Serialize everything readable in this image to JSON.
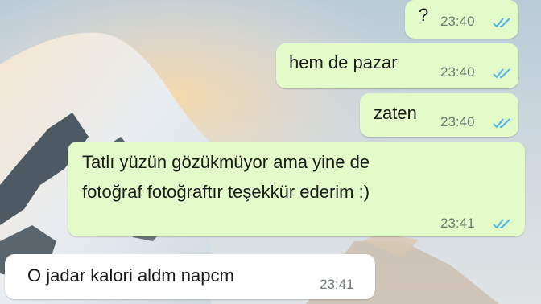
{
  "chat": {
    "messages": [
      {
        "direction": "outgoing",
        "text": "?",
        "time": "23:40",
        "status": "read"
      },
      {
        "direction": "outgoing",
        "text": "hem de pazar",
        "time": "23:40",
        "status": "read"
      },
      {
        "direction": "outgoing",
        "text": "zaten",
        "time": "23:40",
        "status": "read"
      },
      {
        "direction": "outgoing",
        "lines": [
          "Tatlı yüzün gözükmüyor ama yine de",
          "fotoğraf fotoğraftır teşekkür ederim :)"
        ],
        "time": "23:41",
        "status": "read"
      },
      {
        "direction": "incoming",
        "text": "O jadar kalori aldm napcm",
        "time": "23:41"
      }
    ]
  },
  "colors": {
    "outgoing_bubble": "#e2fbc9",
    "incoming_bubble": "#ffffff",
    "read_tick": "#4fb6ec",
    "meta_text": "#6d7a72"
  },
  "wallpaper": {
    "subject": "snowy-mountain-peak-at-sunrise"
  }
}
